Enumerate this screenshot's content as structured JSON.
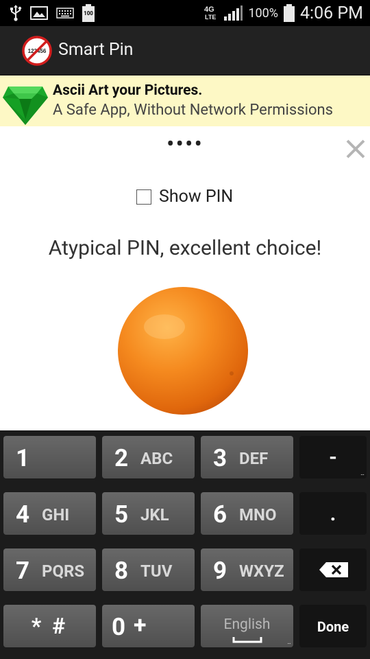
{
  "status_bar": {
    "icons": [
      "usb-icon",
      "image-icon",
      "keyboard-icon",
      "battery-small-icon",
      "4g-lte-icon",
      "signal-icon",
      "battery-icon"
    ],
    "battery_level_badge": "100",
    "network": "4G LTE",
    "battery_percent": "100%",
    "time": "4:06 PM"
  },
  "action_bar": {
    "app_icon_text": "123456",
    "title": "Smart Pin"
  },
  "ad_banner": {
    "title": "Ascii Art your Pictures.",
    "subtitle": "A Safe App, Without Network Permissions"
  },
  "pin_entry": {
    "masked_value": "••••",
    "show_pin_label": "Show PIN",
    "show_pin_checked": false,
    "feedback_message": "Atypical PIN, excellent choice!"
  },
  "keyboard": {
    "rows": [
      [
        {
          "num": "1",
          "letters": ""
        },
        {
          "num": "2",
          "letters": "ABC"
        },
        {
          "num": "3",
          "letters": "DEF"
        },
        {
          "label": "-"
        }
      ],
      [
        {
          "num": "4",
          "letters": "GHI"
        },
        {
          "num": "5",
          "letters": "JKL"
        },
        {
          "num": "6",
          "letters": "MNO"
        },
        {
          "label": "."
        }
      ],
      [
        {
          "num": "7",
          "letters": "PQRS"
        },
        {
          "num": "8",
          "letters": "TUV"
        },
        {
          "num": "9",
          "letters": "WXYZ"
        },
        {
          "icon": "backspace-icon"
        }
      ],
      [
        {
          "label": "* #"
        },
        {
          "num": "0",
          "letters": "+"
        },
        {
          "label": "English"
        },
        {
          "label": "Done"
        }
      ]
    ]
  }
}
